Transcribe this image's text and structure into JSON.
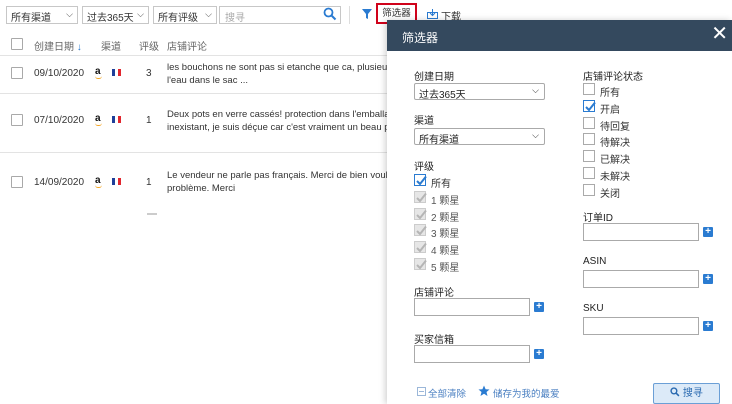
{
  "toolbar": {
    "channel_filter": "所有渠道",
    "date_filter": "过去365天",
    "rating_filter": "所有评级",
    "search_placeholder": "搜寻",
    "filter_button": "筛选器",
    "download_label": "下载"
  },
  "table": {
    "headers": {
      "date": "创建日期",
      "channel": "渠道",
      "rating": "评级",
      "review": "店铺评论"
    },
    "rows": [
      {
        "date": "09/10/2020",
        "channel_icon": "amazon-icon",
        "country_flag": "france-flag-icon",
        "rating": "3",
        "review_line1": "les bouchons ne sont pas si etanche que ca, plusieur fo",
        "review_line2": "l'eau dans le sac ..."
      },
      {
        "date": "07/10/2020",
        "channel_icon": "amazon-icon",
        "country_flag": "france-flag-icon",
        "rating": "1",
        "review_line1": "Deux pots en verre cassés! protection dans l'emballage",
        "review_line2": "inexistant, je suis déçue car c'est vraiment un beau prod"
      },
      {
        "date": "14/09/2020",
        "channel_icon": "amazon-icon",
        "country_flag": "france-flag-icon",
        "rating": "1",
        "review_line1": "Le vendeur ne parle pas français. Merci de bien vouloir r",
        "review_line2": "problème. Merci"
      }
    ]
  },
  "filter_panel": {
    "title": "筛选器",
    "created_date": {
      "label": "创建日期",
      "value": "过去365天"
    },
    "channel": {
      "label": "渠道",
      "value": "所有渠道"
    },
    "rating": {
      "label": "评级",
      "options": [
        {
          "label": "所有",
          "checked": true,
          "disabled": false
        },
        {
          "label": "1 颗星",
          "checked": true,
          "disabled": true
        },
        {
          "label": "2 颗星",
          "checked": true,
          "disabled": true
        },
        {
          "label": "3 颗星",
          "checked": true,
          "disabled": true
        },
        {
          "label": "4 颗星",
          "checked": true,
          "disabled": true
        },
        {
          "label": "5 颗星",
          "checked": true,
          "disabled": true
        }
      ]
    },
    "store_review": {
      "label": "店铺评论",
      "value": ""
    },
    "buyer_message": {
      "label": "买家信箱",
      "value": ""
    },
    "review_status": {
      "label": "店铺评论状态",
      "options": [
        {
          "label": "所有",
          "checked": false
        },
        {
          "label": "开启",
          "checked": true
        },
        {
          "label": "待回复",
          "checked": false
        },
        {
          "label": "待解决",
          "checked": false
        },
        {
          "label": "已解决",
          "checked": false
        },
        {
          "label": "未解决",
          "checked": false
        },
        {
          "label": "关闭",
          "checked": false
        }
      ]
    },
    "order_id": {
      "label": "订单ID",
      "value": ""
    },
    "asin": {
      "label": "ASIN",
      "value": ""
    },
    "sku": {
      "label": "SKU",
      "value": ""
    },
    "clear_all": "全部清除",
    "save_favorite": "储存为我的最爱",
    "search_button": "搜寻"
  },
  "colors": {
    "panel_header": "#34495e",
    "accent_blue": "#2a7bd1",
    "highlight_red": "#d0021b",
    "amazon_orange": "#f5a623"
  }
}
